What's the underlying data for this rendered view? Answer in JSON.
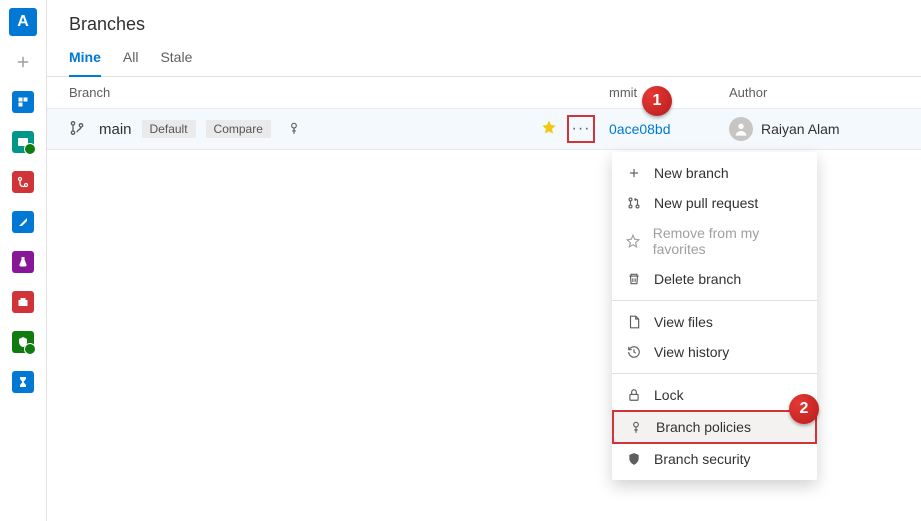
{
  "sidebar": {
    "avatar_letter": "A"
  },
  "page": {
    "title": "Branches"
  },
  "tabs": [
    {
      "label": "Mine",
      "active": true
    },
    {
      "label": "All",
      "active": false
    },
    {
      "label": "Stale",
      "active": false
    }
  ],
  "columns": {
    "branch": "Branch",
    "commit": "mmit",
    "author": "Author"
  },
  "row": {
    "branch_name": "main",
    "default_badge": "Default",
    "compare_badge": "Compare",
    "commit_hash": "0ace08bd",
    "author_name": "Raiyan Alam"
  },
  "menu": {
    "new_branch": "New branch",
    "new_pull_request": "New pull request",
    "remove_favorite": "Remove from my favorites",
    "delete_branch": "Delete branch",
    "view_files": "View files",
    "view_history": "View history",
    "lock": "Lock",
    "branch_policies": "Branch policies",
    "branch_security": "Branch security"
  },
  "callouts": {
    "one": "1",
    "two": "2"
  }
}
